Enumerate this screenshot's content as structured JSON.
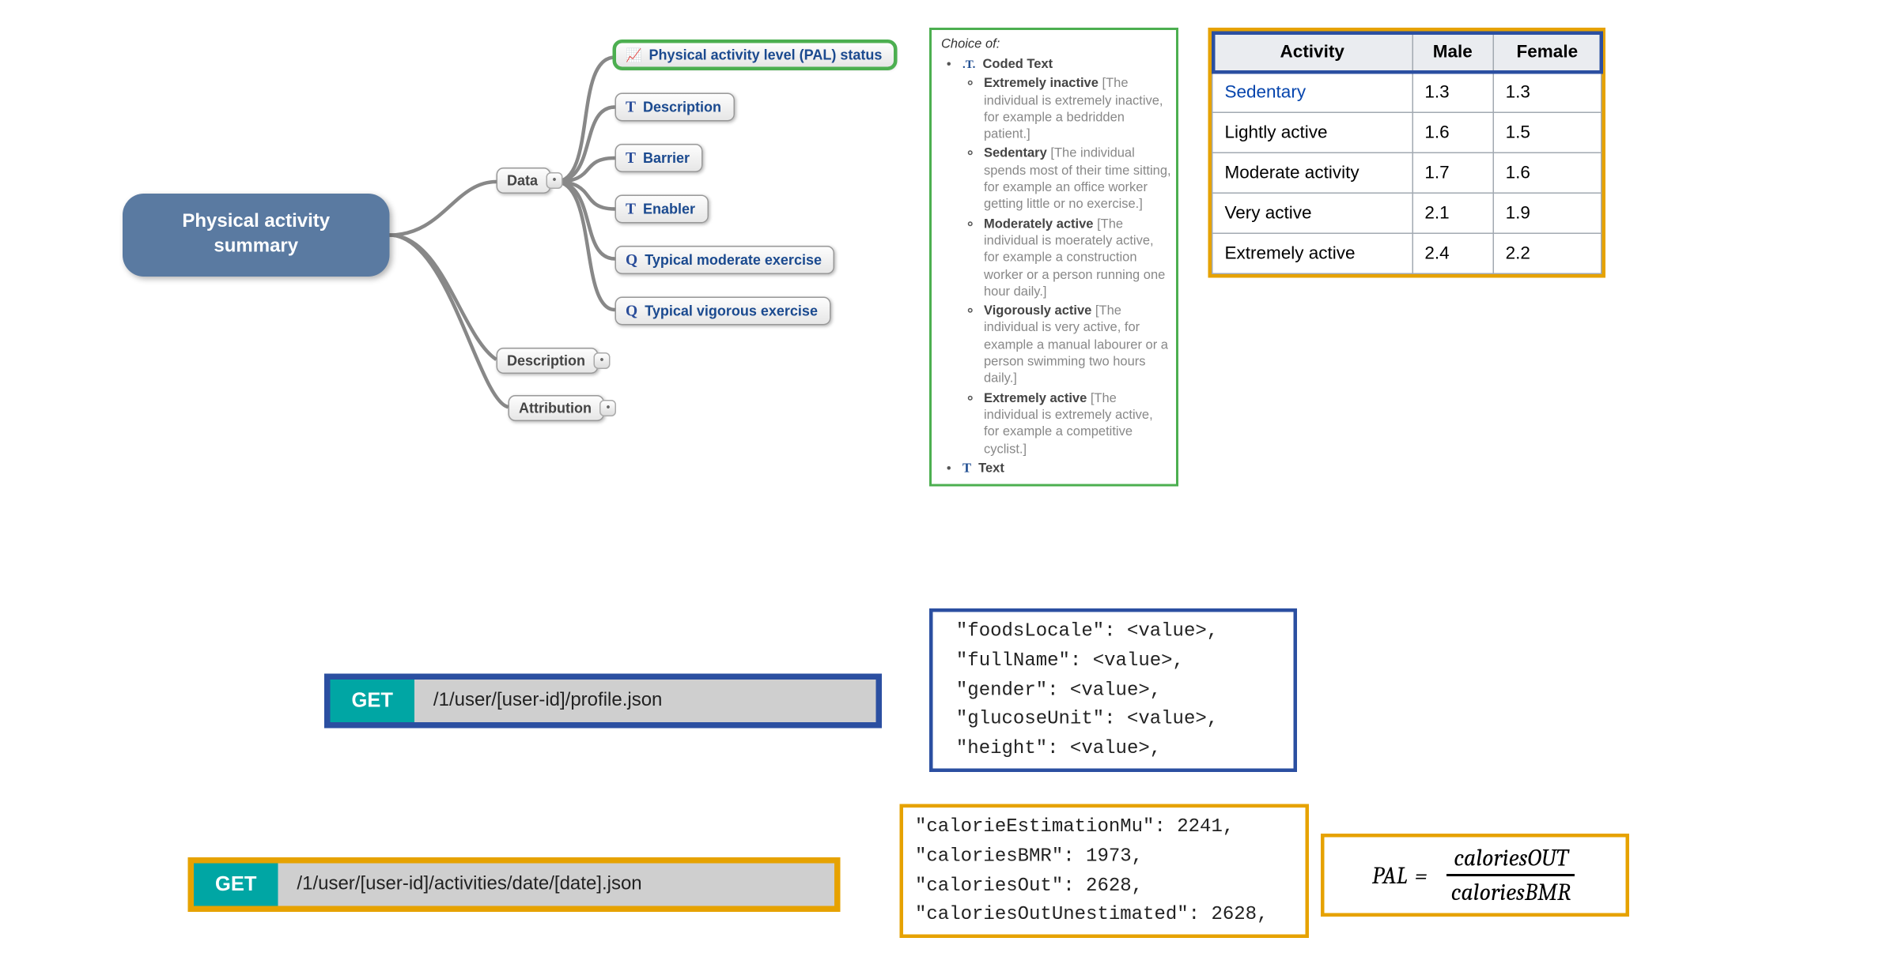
{
  "mindmap": {
    "root": "Physical activity summary",
    "data_label": "Data",
    "description_label": "Description",
    "attribution_label": "Attribution",
    "leaves": {
      "pal": "Physical activity level (PAL) status",
      "description": "Description",
      "barrier": "Barrier",
      "enabler": "Enabler",
      "moderate": "Typical moderate exercise",
      "vigorous": "Typical vigorous exercise"
    }
  },
  "coded": {
    "header": "Choice of:",
    "coded_text": "Coded Text",
    "text": "Text",
    "options": [
      {
        "label": "Extremely inactive",
        "desc": "[The individual is extremely inactive, for example a bedridden patient.]"
      },
      {
        "label": "Sedentary",
        "desc": "[The individual spends most of their time sitting, for example an office worker getting little or no exercise.]"
      },
      {
        "label": "Moderately active",
        "desc": "[The individual is moerately active, for example a construction worker or a person running one hour daily.]"
      },
      {
        "label": "Vigorously active",
        "desc": "[The individual is very active, for example a manual labourer or a person swimming two hours daily.]"
      },
      {
        "label": "Extremely active",
        "desc": "[The individual is extremely active, for example a competitive cyclist.]"
      }
    ]
  },
  "pal_table": {
    "headers": [
      "Activity",
      "Male",
      "Female"
    ],
    "rows": [
      [
        "Sedentary",
        "1.3",
        "1.3"
      ],
      [
        "Lightly active",
        "1.6",
        "1.5"
      ],
      [
        "Moderate activity",
        "1.7",
        "1.6"
      ],
      [
        "Very active",
        "2.1",
        "1.9"
      ],
      [
        "Extremely active",
        "2.4",
        "2.2"
      ]
    ]
  },
  "api": {
    "profile": {
      "method": "GET",
      "path": "/1/user/[user-id]/profile.json"
    },
    "activities": {
      "method": "GET",
      "path": "/1/user/[user-id]/activities/date/[date].json"
    }
  },
  "json_profile": " \"foodsLocale\": <value>,\n \"fullName\": <value>,\n \"gender\": <value>,\n \"glucoseUnit\": <value>,\n \"height\": <value>,",
  "json_activities": "\"calorieEstimationMu\": 2241,\n\"caloriesBMR\": 1973,\n\"caloriesOut\": 2628,\n\"caloriesOutUnestimated\": 2628,",
  "formula": {
    "lhs": "PAL",
    "num": "caloriesOUT",
    "den": "caloriesBMR"
  },
  "chart_data": {
    "type": "table",
    "title": "Physical Activity Level (PAL) factors by activity and sex",
    "columns": [
      "Activity",
      "Male",
      "Female"
    ],
    "rows": [
      [
        "Sedentary",
        1.3,
        1.3
      ],
      [
        "Lightly active",
        1.6,
        1.5
      ],
      [
        "Moderate activity",
        1.7,
        1.6
      ],
      [
        "Very active",
        2.1,
        1.9
      ],
      [
        "Extremely active",
        2.4,
        2.2
      ]
    ]
  }
}
